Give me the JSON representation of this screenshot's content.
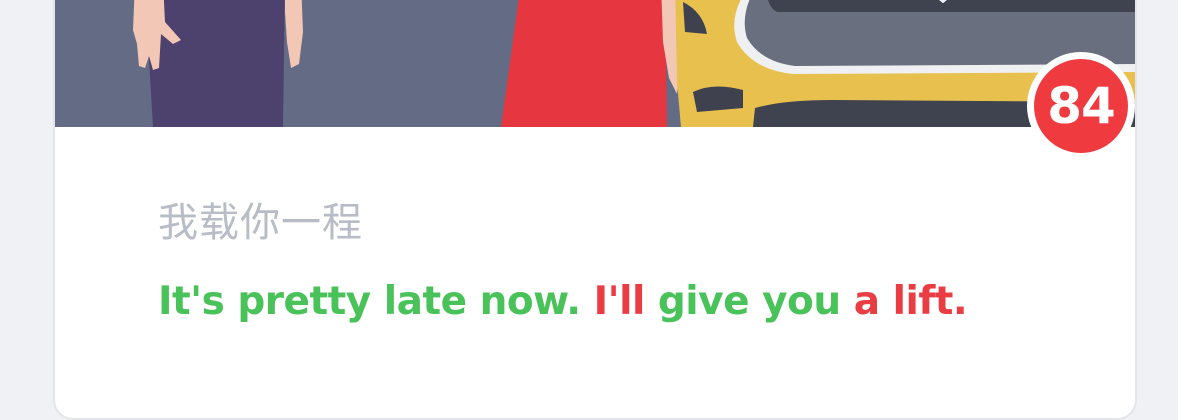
{
  "card": {
    "score": "84",
    "chinese": "我载你一程",
    "sentence_segments": [
      {
        "text": "It's pretty late now. ",
        "status": "correct"
      },
      {
        "text": "I'll",
        "status": "incorrect"
      },
      {
        "text": " give you ",
        "status": "correct"
      },
      {
        "text": "a lift.",
        "status": "incorrect"
      }
    ]
  },
  "colors": {
    "correct": "#4ac25a",
    "incorrect": "#ea3c43",
    "score_badge": "#ef3b40",
    "illustration_bg": "#646c85"
  }
}
